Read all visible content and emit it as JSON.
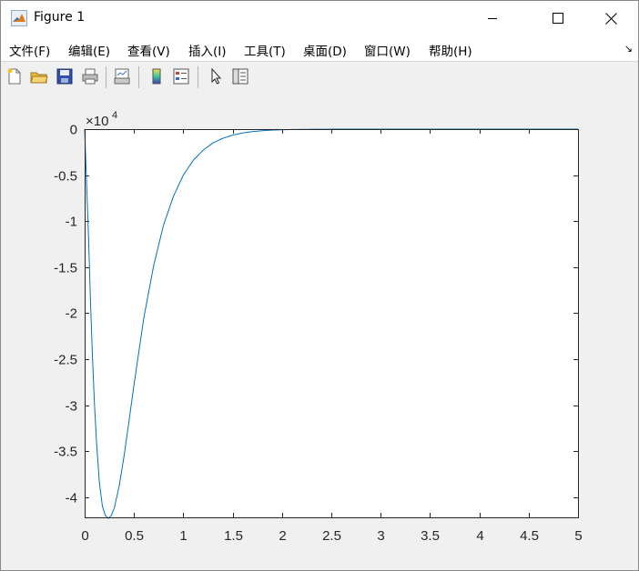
{
  "window": {
    "title": "Figure 1"
  },
  "menu": {
    "items": [
      {
        "label": "文件(F)"
      },
      {
        "label": "编辑(E)"
      },
      {
        "label": "查看(V)"
      },
      {
        "label": "插入(I)"
      },
      {
        "label": "工具(T)"
      },
      {
        "label": "桌面(D)"
      },
      {
        "label": "窗口(W)"
      },
      {
        "label": "帮助(H)"
      }
    ],
    "overflow_arrow": "↘"
  },
  "toolbar": {
    "buttons": [
      {
        "icon": "new-figure-icon"
      },
      {
        "icon": "open-file-icon"
      },
      {
        "icon": "save-icon"
      },
      {
        "icon": "print-icon"
      },
      {
        "icon": "link-plot-icon"
      },
      {
        "icon": "colorbar-icon"
      },
      {
        "icon": "legend-icon"
      },
      {
        "icon": "pointer-icon"
      },
      {
        "icon": "property-editor-icon"
      }
    ]
  },
  "chart_data": {
    "type": "line",
    "xlim": [
      0,
      5
    ],
    "ylim": [
      -4.22,
      0
    ],
    "xticks": [
      0,
      0.5,
      1,
      1.5,
      2,
      2.5,
      3,
      3.5,
      4,
      4.5,
      5
    ],
    "xtick_labels": [
      "0",
      "0.5",
      "1",
      "1.5",
      "2",
      "2.5",
      "3",
      "3.5",
      "4",
      "4.5",
      "5"
    ],
    "yticks": [
      0,
      -0.5,
      -1,
      -1.5,
      -2,
      -2.5,
      -3,
      -3.5,
      -4
    ],
    "ytick_labels": [
      "0",
      "-0.5",
      "-1",
      "-1.5",
      "-2",
      "-2.5",
      "-3",
      "-3.5",
      "-4"
    ],
    "y_exponent_base": "×10",
    "y_exponent_power": "4",
    "grid": false,
    "series": [
      {
        "color": "#0072bd",
        "x": [
          0,
          0.02,
          0.04,
          0.06,
          0.08,
          0.1,
          0.12,
          0.15,
          0.18,
          0.21,
          0.24,
          0.27,
          0.3,
          0.35,
          0.4,
          0.45,
          0.5,
          0.6,
          0.7,
          0.8,
          0.9,
          1.0,
          1.1,
          1.2,
          1.3,
          1.4,
          1.5,
          1.6,
          1.7,
          1.8,
          1.9,
          2.0,
          2.1,
          2.2,
          2.3,
          2.4,
          2.5,
          2.7,
          3.0,
          3.5,
          4.0,
          4.5,
          5.0
        ],
        "y": [
          0,
          -0.6,
          -1.2,
          -1.9,
          -2.5,
          -3.0,
          -3.4,
          -3.85,
          -4.1,
          -4.2,
          -4.23,
          -4.2,
          -4.12,
          -3.88,
          -3.55,
          -3.17,
          -2.78,
          -2.05,
          -1.48,
          -1.04,
          -0.73,
          -0.5,
          -0.34,
          -0.23,
          -0.15,
          -0.1,
          -0.065,
          -0.042,
          -0.027,
          -0.017,
          -0.011,
          -0.007,
          -0.0044,
          -0.0028,
          -0.0017,
          -0.001,
          -0.0006,
          -0.0002,
          0,
          0,
          0,
          0,
          0
        ]
      }
    ]
  }
}
